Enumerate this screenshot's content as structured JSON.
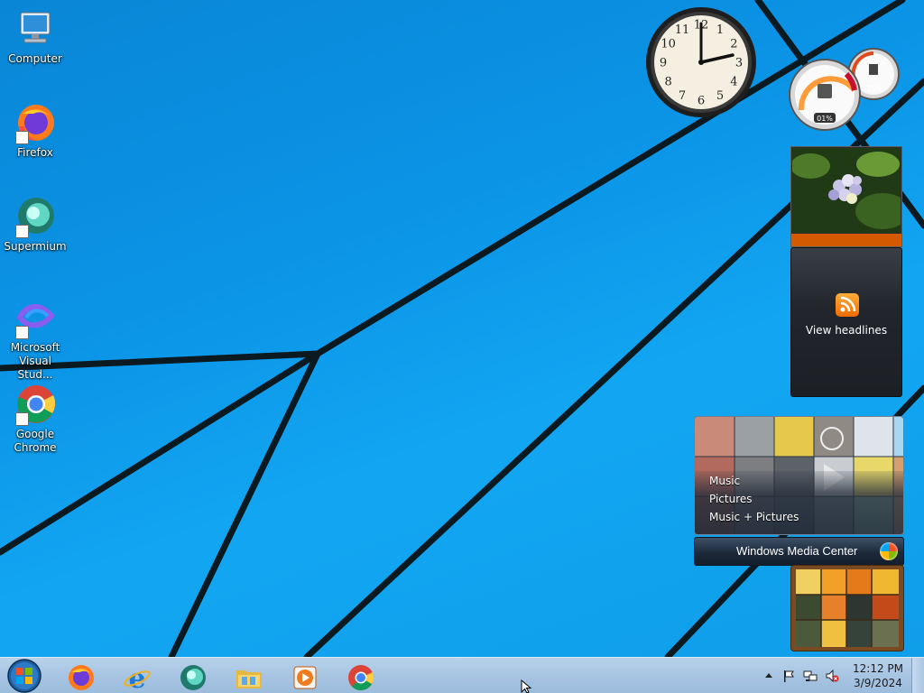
{
  "desktop_icons": [
    {
      "label": "Computer",
      "icon": "computer-icon"
    },
    {
      "label": "Firefox",
      "icon": "firefox-icon"
    },
    {
      "label": "Supermium",
      "icon": "supermium-icon"
    },
    {
      "label": "Microsoft Visual Stud...",
      "icon": "visual-studio-icon"
    },
    {
      "label": "Google Chrome",
      "icon": "chrome-icon"
    }
  ],
  "gadgets": {
    "clock": {
      "numbers": [
        "12",
        "1",
        "2",
        "3",
        "4",
        "5",
        "6",
        "7",
        "8",
        "9",
        "10",
        "11"
      ],
      "time": "12:12"
    },
    "cpu_meter": {
      "cpu": "01%",
      "memory": "25%"
    },
    "feed": {
      "label": "View headlines",
      "icon": "rss-icon"
    },
    "media_center": {
      "items": [
        "Music",
        "Pictures",
        "Music + Pictures"
      ],
      "title": "Windows Media Center"
    }
  },
  "taskbar": {
    "start_icon": "windows-orb-icon",
    "pinned": [
      {
        "name": "firefox",
        "icon": "firefox-icon"
      },
      {
        "name": "internet-explorer",
        "icon": "internet-explorer-icon"
      },
      {
        "name": "supermium",
        "icon": "supermium-icon"
      },
      {
        "name": "file-explorer",
        "icon": "folder-icon"
      },
      {
        "name": "media-player",
        "icon": "media-player-icon"
      },
      {
        "name": "chrome",
        "icon": "chrome-icon"
      }
    ],
    "tray": {
      "icons": [
        "show-hidden-icon",
        "action-center-flag-icon",
        "network-icon",
        "volume-muted-icon"
      ],
      "time": "12:12 PM",
      "date": "3/9/2024"
    }
  },
  "colors": {
    "wallpaper": "#0b94e6",
    "taskbar": "#a7c4e2",
    "feed_accent": "#ef6b00"
  }
}
